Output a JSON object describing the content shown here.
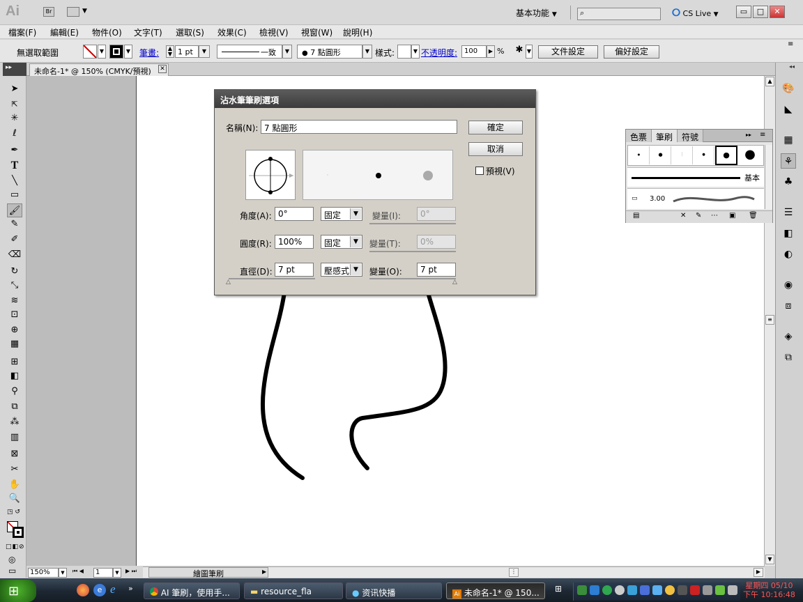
{
  "app": {
    "logo": "Ai",
    "br_label": "Br",
    "workspace": "基本功能",
    "cs_live": "CS Live"
  },
  "window_buttons": [
    "▭",
    "□",
    "✕"
  ],
  "menu": [
    "檔案(F)",
    "編輯(E)",
    "物件(O)",
    "文字(T)",
    "選取(S)",
    "效果(C)",
    "檢視(V)",
    "視窗(W)",
    "說明(H)"
  ],
  "control": {
    "selection": "無選取範圍",
    "stroke_link": "筆畫:",
    "stroke_weight": "1 pt",
    "profile": "一致",
    "brush": "7 點圓形",
    "style_label": "樣式:",
    "opacity_link": "不透明度:",
    "opacity_value": "100",
    "percent": "%",
    "doc_settings": "文件設定",
    "prefs": "偏好設定"
  },
  "document_tab": "未命名-1* @ 150% (CMYK/預視)",
  "dialog": {
    "title": "沾水筆筆刷選項",
    "name_label": "名稱(N):",
    "name_value": "7 點圓形",
    "ok": "確定",
    "cancel": "取消",
    "preview": "預視(V)",
    "angle_label": "角度(A):",
    "angle_value": "0°",
    "angle_mode": "固定",
    "angle_var_label": "變量(I):",
    "angle_var_value": "0°",
    "round_label": "圓度(R):",
    "round_value": "100%",
    "round_mode": "固定",
    "round_var_label": "變量(T):",
    "round_var_value": "0%",
    "diam_label": "直徑(D):",
    "diam_value": "7 pt",
    "diam_mode": "壓感式",
    "diam_var_label": "變量(O):",
    "diam_var_value": "7 pt"
  },
  "brush_panel": {
    "tabs": [
      "色票",
      "筆刷",
      "符號"
    ],
    "basic_label": "基本",
    "art_value": "3.00"
  },
  "status": {
    "zoom": "150%",
    "page": "1",
    "tool_name": "繪圖筆刷"
  },
  "taskbar": {
    "tasks": [
      "AI 筆刷，使用手...",
      "resource_fla",
      "资讯快播",
      "未命名-1* @ 150..."
    ],
    "clock_day": "星期四 05/10",
    "clock_time": "下午 10:16:48"
  },
  "colors": {
    "dialog_title": "#4a4a4a",
    "taskbar": "#1d2733",
    "active_task": "#3a3a3a"
  }
}
